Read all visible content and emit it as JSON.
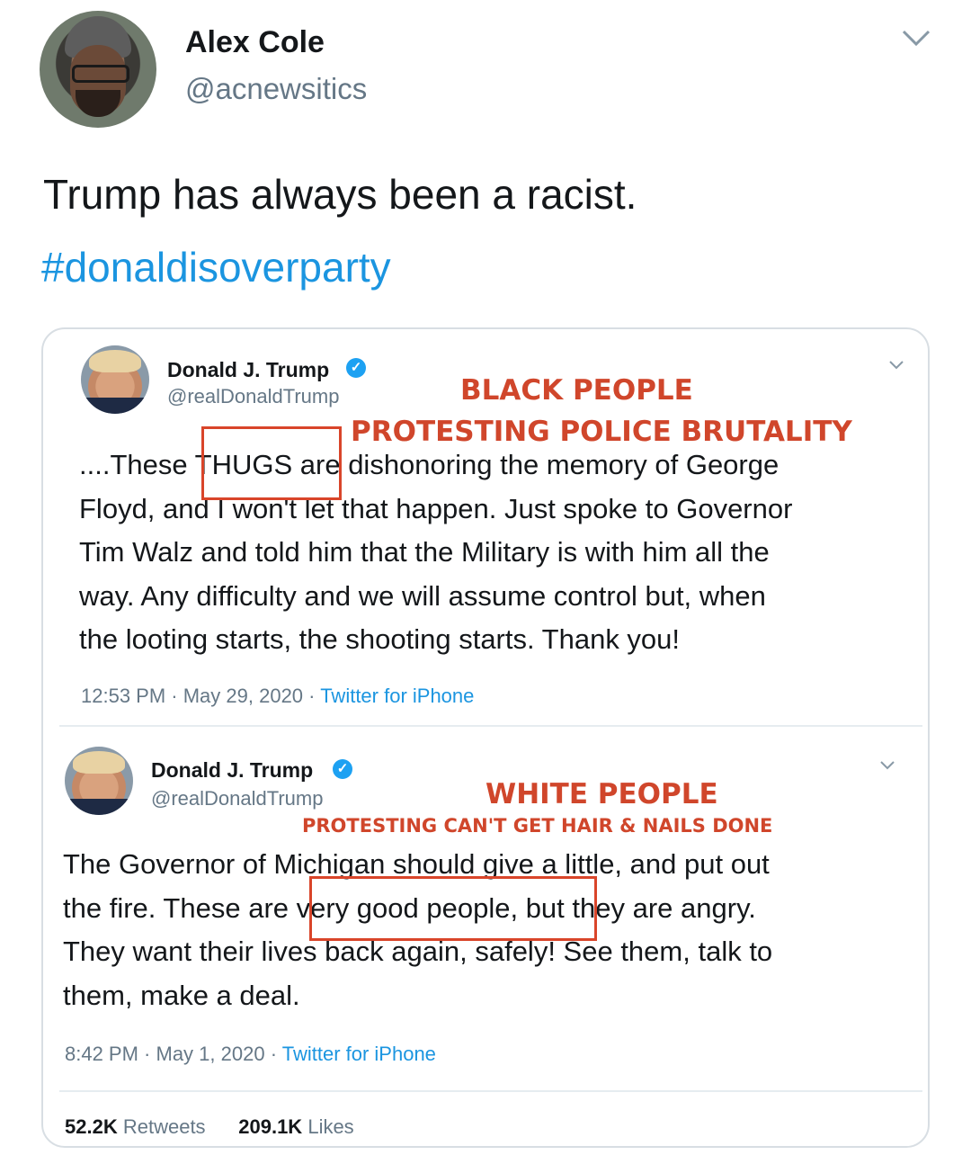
{
  "outer_tweet": {
    "author_name": "Alex Cole",
    "author_handle": "@acnewsitics",
    "text": "Trump has always been a racist.",
    "hashtag": "#donaldisoverparty"
  },
  "quoted_tweets": [
    {
      "author_name": "Donald J. Trump",
      "author_handle": "@realDonaldTrump",
      "lines": [
        "....These THUGS are dishonoring the memory of George",
        "Floyd, and I won't let that happen. Just spoke to Governor",
        "Tim Walz and told him that the Military is with him all the",
        "way. Any difficulty and we will assume control but, when",
        "the looting starts, the shooting starts. Thank you!"
      ],
      "time": "12:53 PM",
      "date": "May 29, 2020",
      "source": "Twitter for iPhone",
      "annotation_title": "BLACK PEOPLE",
      "annotation_subtitle": "PROTESTING POLICE BRUTALITY"
    },
    {
      "author_name": "Donald J. Trump",
      "author_handle": "@realDonaldTrump",
      "lines": [
        "The Governor of Michigan should give a little, and put out",
        "the fire. These are very good people, but they are angry.",
        "They want their lives back again, safely! See them, talk to",
        "them, make a deal."
      ],
      "time": "8:42 PM",
      "date": "May 1, 2020",
      "source": "Twitter for iPhone",
      "annotation_title": "WHITE PEOPLE",
      "annotation_subtitle": "PROTESTING CAN'T GET HAIR & NAILS DONE"
    }
  ],
  "stats": {
    "retweets_count": "52.2K",
    "retweets_label": "Retweets",
    "likes_count": "209.1K",
    "likes_label": "Likes"
  },
  "colors": {
    "link": "#1b95e0",
    "annotation_red": "#d0462b",
    "verified": "#1da1f2"
  }
}
